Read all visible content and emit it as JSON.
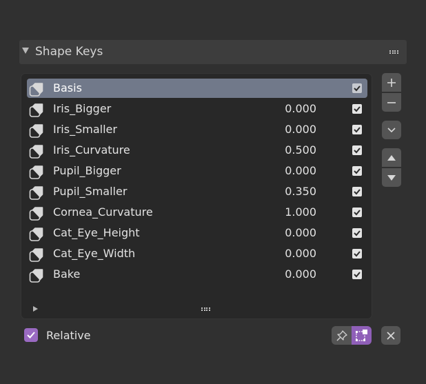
{
  "panel": {
    "title": "Shape Keys",
    "icons": {
      "collapse": "triangle-down-icon",
      "drag": "drag-handle-icon"
    }
  },
  "shape_keys": [
    {
      "name": "Basis",
      "value": "",
      "enabled": true,
      "active": true
    },
    {
      "name": "Iris_Bigger",
      "value": "0.000",
      "enabled": true,
      "active": false
    },
    {
      "name": "Iris_Smaller",
      "value": "0.000",
      "enabled": true,
      "active": false
    },
    {
      "name": "Iris_Curvature",
      "value": "0.500",
      "enabled": true,
      "active": false
    },
    {
      "name": "Pupil_Bigger",
      "value": "0.000",
      "enabled": true,
      "active": false
    },
    {
      "name": "Pupil_Smaller",
      "value": "0.350",
      "enabled": true,
      "active": false
    },
    {
      "name": "Cornea_Curvature",
      "value": "1.000",
      "enabled": true,
      "active": false
    },
    {
      "name": "Cat_Eye_Height",
      "value": "0.000",
      "enabled": true,
      "active": false
    },
    {
      "name": "Cat_Eye_Width",
      "value": "0.000",
      "enabled": true,
      "active": false
    },
    {
      "name": "Bake",
      "value": "0.000",
      "enabled": true,
      "active": false
    }
  ],
  "side_buttons": {
    "add": "plus-icon",
    "remove": "minus-icon",
    "specials": "chevron-down-icon",
    "move_up": "triangle-up-icon",
    "move_down": "triangle-down-icon"
  },
  "relative": {
    "label": "Relative",
    "checked": true
  },
  "footer_buttons": {
    "pin": "pin-icon",
    "edit_mode": "edit-mode-icon",
    "clear": "close-icon"
  },
  "colors": {
    "background": "#303030",
    "panel_header": "#3d3d3d",
    "list_background": "#282828",
    "active_row": "#71798a",
    "accent": "#9a6ac2",
    "button": "#545454"
  }
}
